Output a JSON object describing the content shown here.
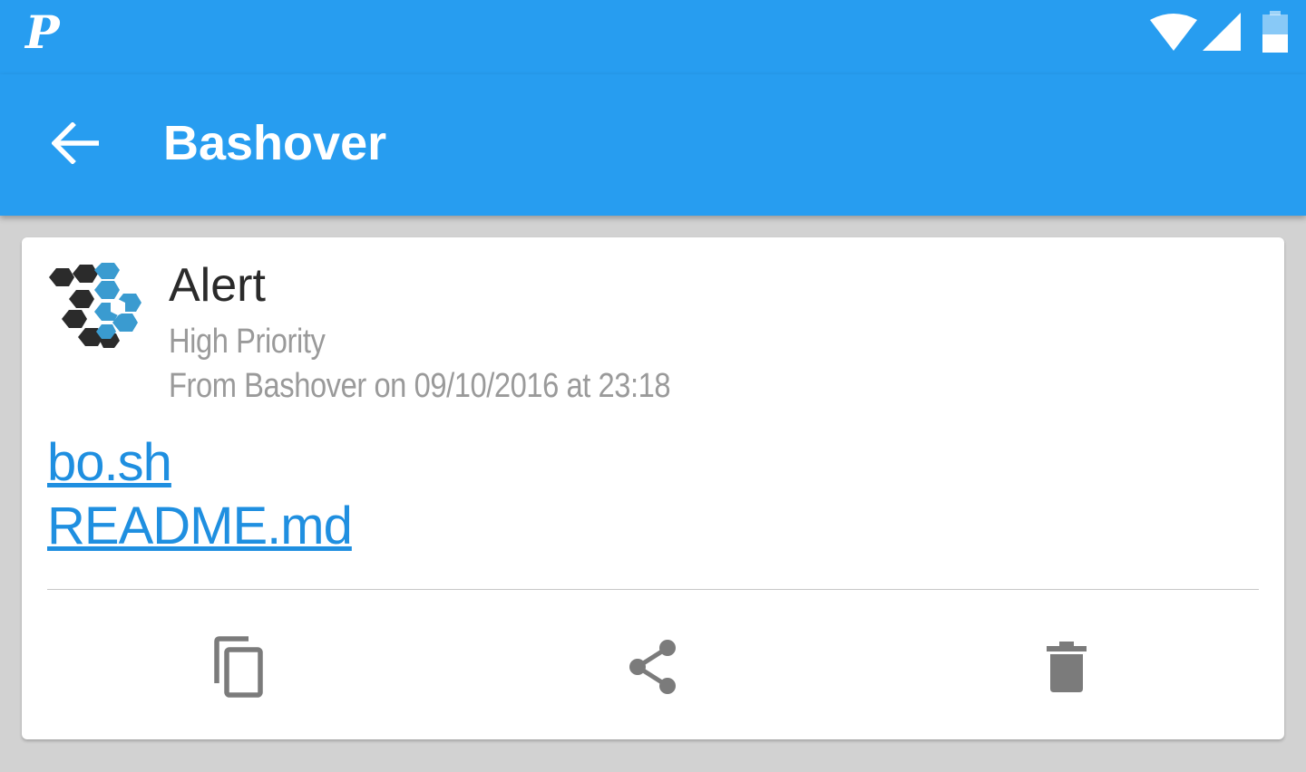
{
  "status_bar": {
    "app_logo": "P",
    "icons": [
      "pushover-logo",
      "wifi-icon",
      "signal-icon",
      "battery-icon"
    ]
  },
  "app_bar": {
    "title": "Bashover",
    "back_icon": "arrow-back-icon"
  },
  "message": {
    "title": "Alert",
    "priority": "High Priority",
    "meta": "From Bashover on 09/10/2016 at 23:18",
    "links": [
      "bo.sh",
      "README.md"
    ],
    "actions": [
      "copy-icon",
      "share-icon",
      "delete-icon"
    ]
  },
  "colors": {
    "primary": "#279df0",
    "link": "#1f8fe0",
    "secondary_text": "#9a9a9a",
    "icon_gray": "#7b7b7b",
    "background": "#d2d2d2"
  }
}
